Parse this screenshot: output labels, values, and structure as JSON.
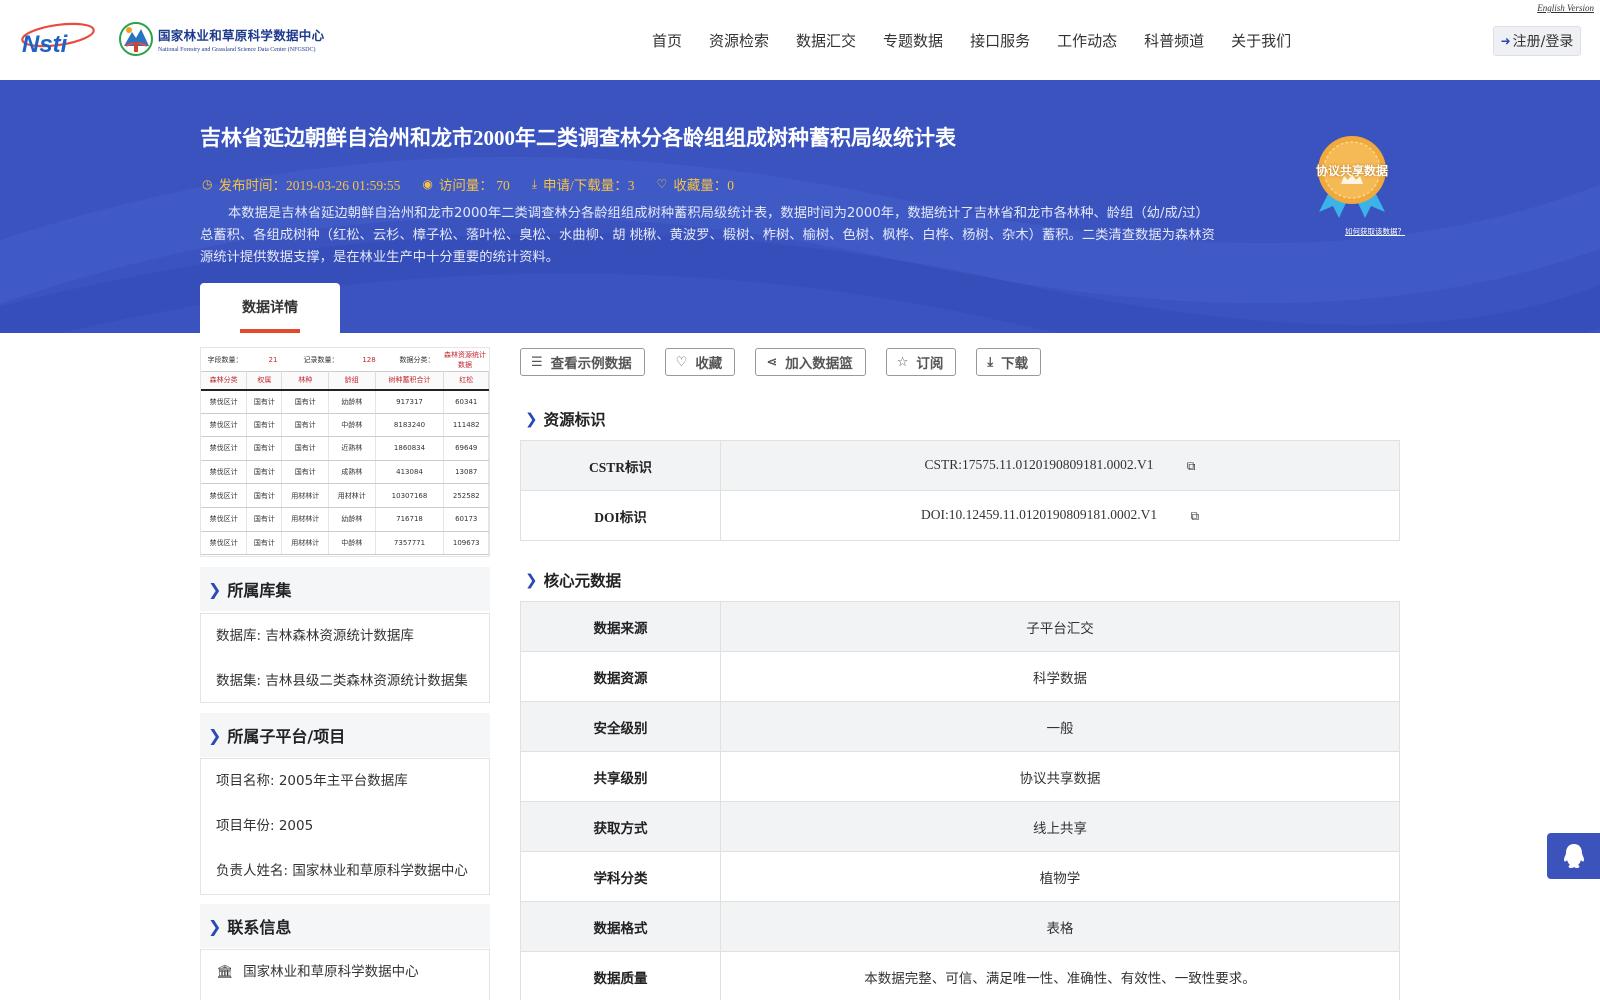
{
  "header": {
    "english_link": "English Version",
    "center_name_cn": "国家林业和草原科学数据中心",
    "center_name_en": "National Forestry and Grassland Science Data Center (NFGSDC)",
    "nav": [
      "首页",
      "资源检索",
      "数据汇交",
      "专题数据",
      "接口服务",
      "工作动态",
      "科普频道",
      "关于我们"
    ],
    "login_label": "注册/登录"
  },
  "banner": {
    "title": "吉林省延边朝鲜自治州和龙市2000年二类调查林分各龄组组成树种蓄积局级统计表",
    "publish_label": "发布时间：2019-03-26 01:59:55",
    "views_label": "访问量： 70",
    "downloads_label": "申请/下载量：3",
    "favorites_label": "收藏量：0",
    "description": "本数据是吉林省延边朝鲜自治州和龙市2000年二类调查林分各龄组组成树种蓄积局级统计表，数据时间为2000年，数据统计了吉林省和龙市各林种、龄组（幼/成/过）总蓄积、各组成树种（红松、云杉、樟子松、落叶松、臭松、水曲柳、胡 桃楸、黄波罗、椴树、柞树、榆树、色树、枫桦、白桦、杨树、杂木）蓄积。二类清查数据为森林资源统计提供数据支撑，是在林业生产中十分重要的统计资料。",
    "badge_label": "协议共享数据",
    "howto_label": "如何获取该数据？",
    "tab_label": "数据详情"
  },
  "preview": {
    "summary": [
      "字段数量：",
      "21",
      "记录数量：",
      "128",
      "数据分类：",
      "森林资源统计数据"
    ],
    "headers": [
      "森林分类",
      "权属",
      "林种",
      "龄组",
      "树种蓄积合计",
      "红松"
    ],
    "rows": [
      [
        "禁伐区计",
        "国有计",
        "国有计",
        "幼龄林",
        "917317",
        "60341"
      ],
      [
        "禁伐区计",
        "国有计",
        "国有计",
        "中龄林",
        "8183240",
        "111482"
      ],
      [
        "禁伐区计",
        "国有计",
        "国有计",
        "近熟林",
        "1860834",
        "69649"
      ],
      [
        "禁伐区计",
        "国有计",
        "国有计",
        "成熟林",
        "413084",
        "13087"
      ],
      [
        "禁伐区计",
        "国有计",
        "用材林计",
        "用材林计",
        "10307168",
        "252582"
      ],
      [
        "禁伐区计",
        "国有计",
        "用材林计",
        "幼龄林",
        "716718",
        "60173"
      ],
      [
        "禁伐区计",
        "国有计",
        "用材林计",
        "中龄林",
        "7357771",
        "109673"
      ]
    ]
  },
  "library": {
    "title": "所属库集",
    "items": [
      "数据库: 吉林森林资源统计数据库",
      "数据集: 吉林县级二类森林资源统计数据集"
    ]
  },
  "project": {
    "title": "所属子平台/项目",
    "items": [
      "项目名称: 2005年主平台数据库",
      "项目年份: 2005",
      "负责人姓名: 国家林业和草原科学数据中心"
    ]
  },
  "contact": {
    "title": "联系信息",
    "org": "国家林业和草原科学数据中心"
  },
  "toolbar": {
    "sample_label": "查看示例数据",
    "favorite_label": "收藏",
    "basket_label": "加入数据篮",
    "subscribe_label": "订阅",
    "download_label": "下载"
  },
  "resource_id": {
    "title": "资源标识",
    "rows": [
      {
        "key": "CSTR标识",
        "value": "CSTR:17575.11.0120190809181.0002.V1"
      },
      {
        "key": "DOI标识",
        "value": "DOI:10.12459.11.0120190809181.0002.V1"
      }
    ]
  },
  "core_meta": {
    "title": "核心元数据",
    "rows": [
      {
        "key": "数据来源",
        "value": "子平台汇交"
      },
      {
        "key": "数据资源",
        "value": "科学数据"
      },
      {
        "key": "安全级别",
        "value": "一般"
      },
      {
        "key": "共享级别",
        "value": "协议共享数据"
      },
      {
        "key": "获取方式",
        "value": "线上共享"
      },
      {
        "key": "学科分类",
        "value": "植物学"
      },
      {
        "key": "数据格式",
        "value": "表格"
      },
      {
        "key": "数据质量",
        "value": "本数据完整、可信、满足唯一性、准确性、有效性、一致性要求。"
      }
    ]
  },
  "colors": {
    "banner_blue": "#3a53bf",
    "accent_gold": "#f6c343",
    "tab_underline": "#e2492e"
  }
}
